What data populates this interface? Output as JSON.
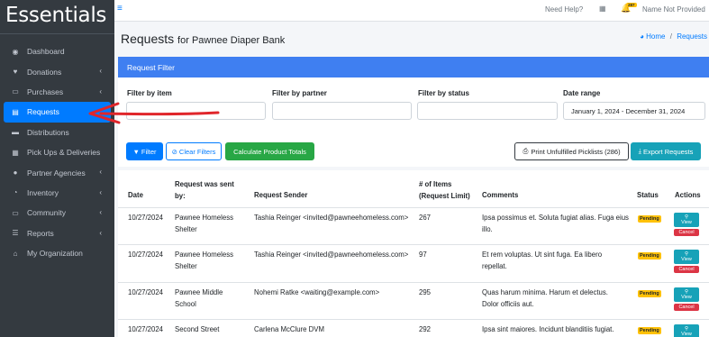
{
  "sidebar": {
    "brand": "Essentials",
    "items": [
      {
        "label": "Dashboard",
        "icon": "gauge-icon",
        "glyph": "◉",
        "chevron": false
      },
      {
        "label": "Donations",
        "icon": "heart-icon",
        "glyph": "♥",
        "chevron": true
      },
      {
        "label": "Purchases",
        "icon": "money-icon",
        "glyph": "▭",
        "chevron": true
      },
      {
        "label": "Requests",
        "icon": "file-icon",
        "glyph": "▤",
        "chevron": false,
        "active": true
      },
      {
        "label": "Distributions",
        "icon": "truck-icon",
        "glyph": "▬",
        "chevron": false
      },
      {
        "label": "Pick Ups & Deliveries",
        "icon": "calendar-icon",
        "glyph": "▦",
        "chevron": false
      },
      {
        "label": "Partner Agencies",
        "icon": "users-icon",
        "glyph": "●",
        "chevron": true
      },
      {
        "label": "Inventory",
        "icon": "pie-icon",
        "glyph": "◔",
        "chevron": true
      },
      {
        "label": "Community",
        "icon": "desktop-icon",
        "glyph": "▭",
        "chevron": true
      },
      {
        "label": "Reports",
        "icon": "list-icon",
        "glyph": "☰",
        "chevron": true
      },
      {
        "label": "My Organization",
        "icon": "building-icon",
        "glyph": "⌂",
        "chevron": false
      }
    ]
  },
  "topbar": {
    "menu_glyph": "≡",
    "help": "Need Help?",
    "cal_glyph": "▦",
    "bell_glyph": "🔔",
    "notif_count": "287",
    "user": "Name Not Provided"
  },
  "header": {
    "title": "Requests",
    "subtitle": "for Pawnee Diaper Bank",
    "breadcrumb_home": "Home",
    "breadcrumb_sep": "/",
    "breadcrumb_current": "Requests"
  },
  "filter": {
    "heading": "Request Filter",
    "item_label": "Filter by item",
    "partner_label": "Filter by partner",
    "status_label": "Filter by status",
    "date_label": "Date range",
    "item_value": "",
    "partner_value": "",
    "status_value": "",
    "date_value": "January 1, 2024 - December 31, 2024",
    "filter_button": "Filter",
    "clear_button": "Clear Filters",
    "totals_button": "Calculate Product Totals",
    "print_button": "Print Unfulfilled Picklists (286)",
    "export_button": "Export Requests"
  },
  "table": {
    "headers": {
      "date": "Date",
      "sent_by_1": "Request was sent",
      "sent_by_2": "by:",
      "sender": "Request Sender",
      "items_1": "# of Items",
      "items_2": "(Request Limit)",
      "comments": "Comments",
      "status": "Status",
      "actions": "Actions"
    },
    "view_label": "View",
    "cancel_label": "Cancel",
    "rows": [
      {
        "date": "10/27/2024",
        "sent_by_1": "Pawnee Homeless",
        "sent_by_2": "Shelter",
        "sender": "Tashia Reinger <invited@pawneehomeless.com>",
        "items": "267",
        "comment_1": "Ipsa possimus et. Soluta fugiat alias. Fuga eius",
        "comment_2": "illo.",
        "status": "Pending"
      },
      {
        "date": "10/27/2024",
        "sent_by_1": "Pawnee Homeless",
        "sent_by_2": "Shelter",
        "sender": "Tashia Reinger <invited@pawneehomeless.com>",
        "items": "97",
        "comment_1": "Et rem voluptas. Ut sint fuga. Ea libero",
        "comment_2": "repellat.",
        "status": "Pending"
      },
      {
        "date": "10/27/2024",
        "sent_by_1": "Pawnee Middle",
        "sent_by_2": "School",
        "sender": "Nohemi Ratke <waiting@example.com>",
        "items": "295",
        "comment_1": "Quas harum minima. Harum et delectus.",
        "comment_2": "Dolor officiis aut.",
        "status": "Pending"
      },
      {
        "date": "10/27/2024",
        "sent_by_1": "Second Street",
        "sent_by_2": "",
        "sender": "Carlena McClure DVM",
        "items": "292",
        "comment_1": "Ipsa sint maiores. Incidunt blanditiis fugiat.",
        "comment_2": "",
        "status": "Pending"
      }
    ]
  },
  "colors": {
    "sidebar": "#343a40",
    "primary": "#007bff",
    "filter_header": "#3f7ff1",
    "success": "#28a745",
    "info": "#17a2b8",
    "danger": "#dc3545",
    "warning": "#ffc107",
    "annotation_arrow": "#e0262b"
  }
}
